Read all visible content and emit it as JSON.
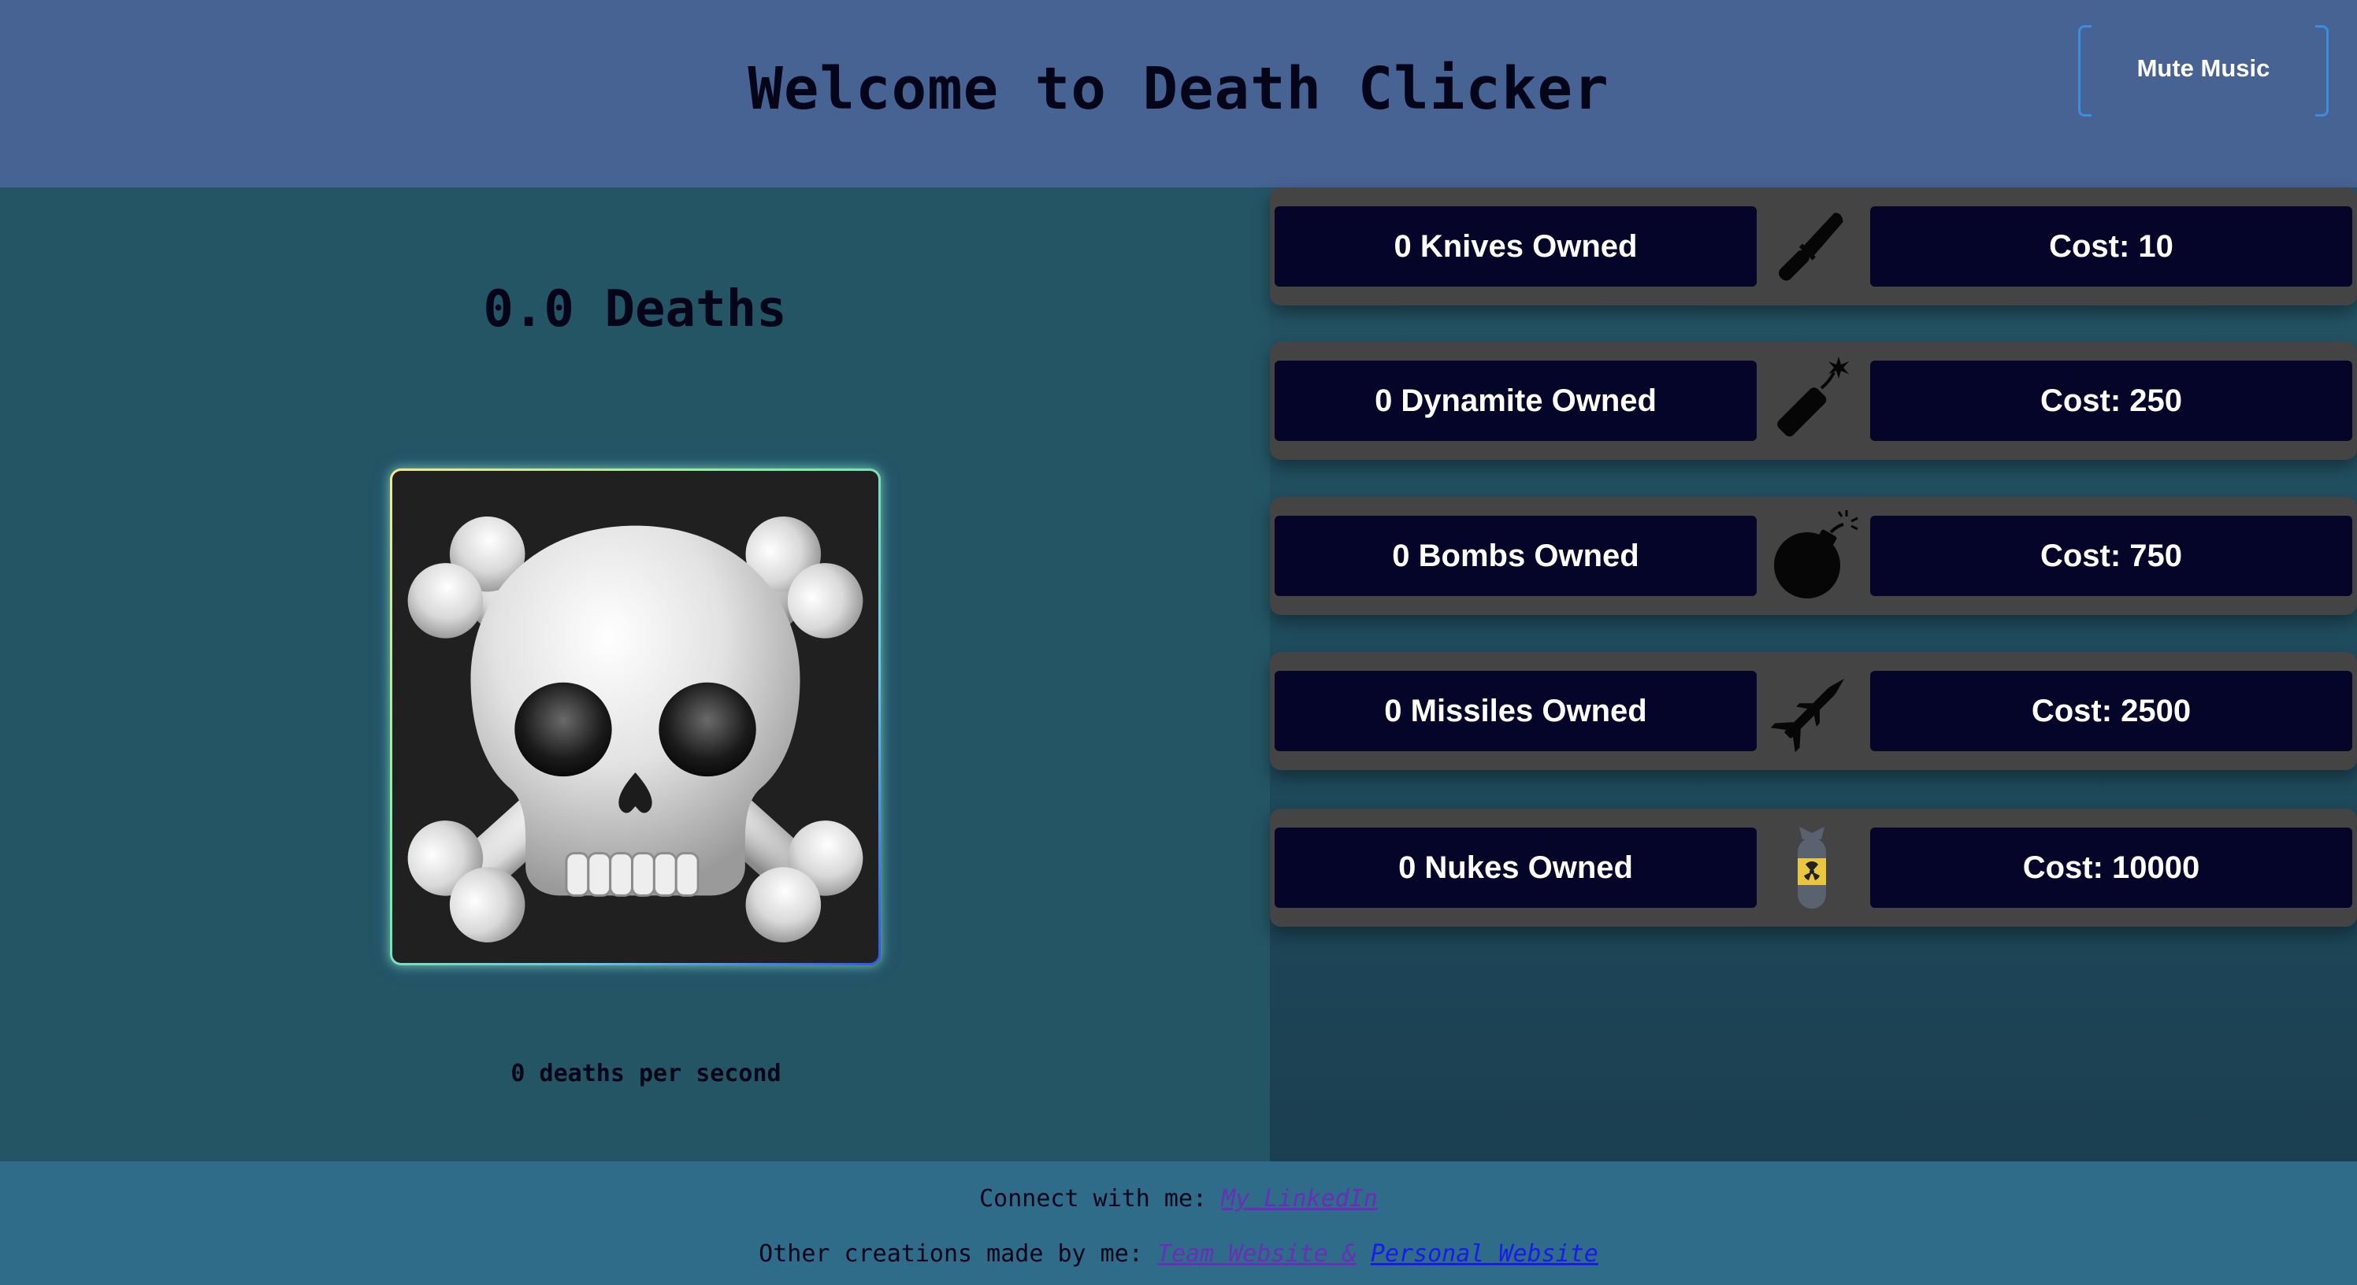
{
  "header": {
    "title": "Welcome to Death Clicker",
    "mute_button_label": "Mute Music"
  },
  "game": {
    "death_count": "0.0 Deaths",
    "deaths_per_second": "0 deaths per second",
    "clicker_icon": "skull-and-crossbones"
  },
  "shop": {
    "items": [
      {
        "owned_label": "0 Knives Owned",
        "cost_label": "Cost: 10",
        "icon": "knife-icon"
      },
      {
        "owned_label": "0 Dynamite Owned",
        "cost_label": "Cost: 250",
        "icon": "dynamite-icon"
      },
      {
        "owned_label": "0 Bombs Owned",
        "cost_label": "Cost: 750",
        "icon": "bomb-icon"
      },
      {
        "owned_label": "0 Missiles Owned",
        "cost_label": "Cost: 2500",
        "icon": "missile-icon"
      },
      {
        "owned_label": "0 Nukes Owned",
        "cost_label": "Cost: 10000",
        "icon": "nuke-icon"
      }
    ]
  },
  "footer": {
    "connect_prefix": "Connect with me:",
    "linkedin_label": "My LinkedIn",
    "creations_prefix": "Other creations made by me:",
    "team_website_label": "Team Website &",
    "personal_website_label": "Personal Website"
  },
  "colors": {
    "header_bg": "#466394",
    "left_panel_bg": "#245565",
    "shop_row_bg": "#444444",
    "shop_box_bg": "#05052a",
    "footer_bg": "#2e6c8a",
    "accent_border": "#3b8ede",
    "nuke_hazard": "#e8c640"
  }
}
